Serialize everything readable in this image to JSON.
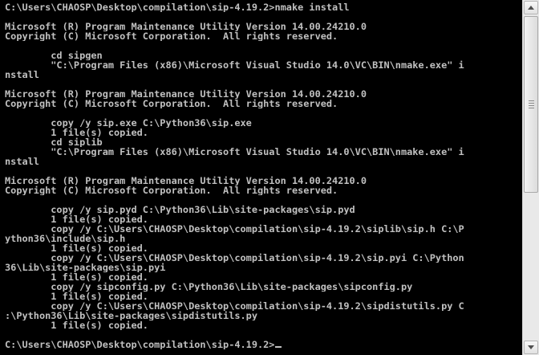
{
  "terminal": {
    "lines": [
      "C:\\Users\\CHAOSP\\Desktop\\compilation\\sip-4.19.2>nmake install",
      "",
      "Microsoft (R) Program Maintenance Utility Version 14.00.24210.0",
      "Copyright (C) Microsoft Corporation.  All rights reserved.",
      "",
      "        cd sipgen",
      "        \"C:\\Program Files (x86)\\Microsoft Visual Studio 14.0\\VC\\BIN\\nmake.exe\" i",
      "nstall",
      "",
      "Microsoft (R) Program Maintenance Utility Version 14.00.24210.0",
      "Copyright (C) Microsoft Corporation.  All rights reserved.",
      "",
      "        copy /y sip.exe C:\\Python36\\sip.exe",
      "        1 file(s) copied.",
      "        cd siplib",
      "        \"C:\\Program Files (x86)\\Microsoft Visual Studio 14.0\\VC\\BIN\\nmake.exe\" i",
      "nstall",
      "",
      "Microsoft (R) Program Maintenance Utility Version 14.00.24210.0",
      "Copyright (C) Microsoft Corporation.  All rights reserved.",
      "",
      "        copy /y sip.pyd C:\\Python36\\Lib\\site-packages\\sip.pyd",
      "        1 file(s) copied.",
      "        copy /y C:\\Users\\CHAOSP\\Desktop\\compilation\\sip-4.19.2\\siplib\\sip.h C:\\P",
      "ython36\\include\\sip.h",
      "        1 file(s) copied.",
      "        copy /y C:\\Users\\CHAOSP\\Desktop\\compilation\\sip-4.19.2\\sip.pyi C:\\Python",
      "36\\Lib\\site-packages\\sip.pyi",
      "        1 file(s) copied.",
      "        copy /y sipconfig.py C:\\Python36\\Lib\\site-packages\\sipconfig.py",
      "        1 file(s) copied.",
      "        copy /y C:\\Users\\CHAOSP\\Desktop\\compilation\\sip-4.19.2\\sipdistutils.py C",
      ":\\Python36\\Lib\\site-packages\\sipdistutils.py",
      "        1 file(s) copied.",
      ""
    ],
    "prompt": "C:\\Users\\CHAOSP\\Desktop\\compilation\\sip-4.19.2>"
  },
  "colors": {
    "background": "#000000",
    "foreground": "#c0c0c0"
  }
}
